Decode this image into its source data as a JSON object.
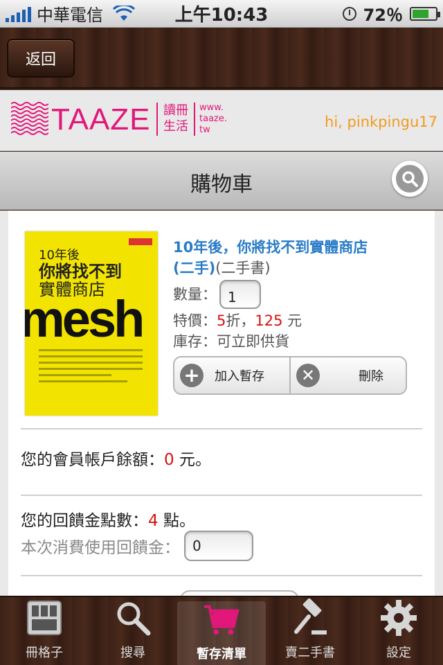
{
  "status_bar": {
    "carrier": "中華電信",
    "time": "上午10:43",
    "battery": "72％",
    "battery_level": 0.72
  },
  "nav": {
    "back_label": "返回"
  },
  "brand": {
    "logo_text": "TAAZE",
    "logo_cn_line1": "讀冊",
    "logo_cn_line2": "生活",
    "logo_url_line1": "www.",
    "logo_url_line2": "taaze.",
    "logo_url_line3": "tw",
    "greeting": "hi, pinkpingu17"
  },
  "page": {
    "title": "購物車"
  },
  "cart_item": {
    "title": "10年後，你將找不到實體商店",
    "condition_link": "(二手)",
    "condition_note": "(二手書)",
    "qty_label": "數量：",
    "qty_value": "1",
    "price_label": "特價：",
    "discount": "5",
    "discount_unit": "折，",
    "price": "125",
    "price_unit": " 元",
    "stock_label": "庫存：",
    "stock_value": "可立即供貨",
    "add_wishlist_label": "加入暫存",
    "delete_label": "刪除",
    "cover": {
      "line1": "10年後",
      "line2": "你將找不到",
      "line3": "實體商店",
      "word": "mesh"
    }
  },
  "account": {
    "balance_label": "您的會員帳戶餘額：",
    "balance_value": "0",
    "balance_unit": " 元。",
    "bonus_label": "您的回饋金點數：",
    "bonus_value": "4",
    "bonus_unit": " 點。",
    "bonus_use_label": "本次消費使用回饋金：",
    "bonus_use_value": "0"
  },
  "tabs": [
    {
      "label": "冊格子",
      "icon": "grid-icon"
    },
    {
      "label": "搜尋",
      "icon": "magnifier-icon"
    },
    {
      "label": "暫存清單",
      "icon": "cart-icon",
      "active": true
    },
    {
      "label": "賣二手書",
      "icon": "gavel-icon"
    },
    {
      "label": "設定",
      "icon": "gear-icon"
    }
  ],
  "colors": {
    "brand_pink": "#e2177a",
    "greeting_orange": "#f19a1f",
    "title_blue": "#2a7cc7",
    "price_red": "#d81010"
  }
}
